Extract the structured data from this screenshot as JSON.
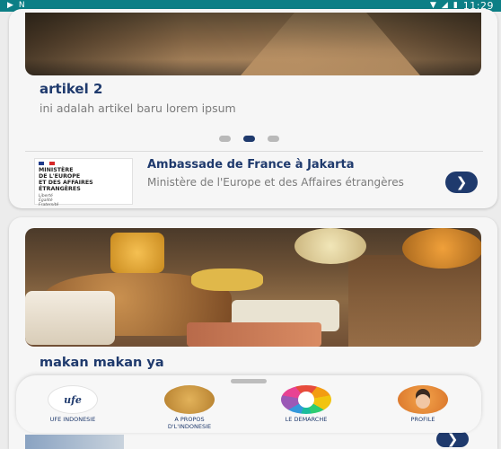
{
  "status_bar": {
    "time": "11:29",
    "left_icons": [
      "video-icon",
      "nfc-icon"
    ],
    "right_icons": [
      "wifi-icon",
      "signal-icon",
      "battery-icon"
    ],
    "background": "#0c7f86"
  },
  "carousel": {
    "article_title": "artikel 2",
    "article_description": "ini adalah artikel baru lorem ipsum",
    "dots": 3,
    "active_dot": 1
  },
  "embassy": {
    "logo_lines": "MINISTÈRE\nDE L'EUROPE\nET DES AFFAIRES\nÉTRANGÈRES",
    "logo_motto": "Liberté\nÉgalité\nFraternité",
    "title": "Ambassade de France à Jakarta",
    "subtitle": "Ministère de l'Europe et des Affaires étrangères",
    "arrow": "❯"
  },
  "food_card": {
    "title": "makan makan ya"
  },
  "bottom_nav": {
    "items": [
      {
        "label": "UFE INDONESIE",
        "icon": "ufe-logo-icon",
        "icon_text": "ufe"
      },
      {
        "label": "A PROPOS\nD'L'INDONESIE",
        "icon": "indonesia-map-icon"
      },
      {
        "label": "LE DEMARCHE",
        "icon": "demarche-wheel-icon"
      },
      {
        "label": "PROFILE",
        "icon": "profile-avatar-icon"
      }
    ]
  },
  "colors": {
    "accent": "#1f3a6d",
    "muted_text": "#7b7b7b",
    "card_bg": "#f6f6f6"
  }
}
